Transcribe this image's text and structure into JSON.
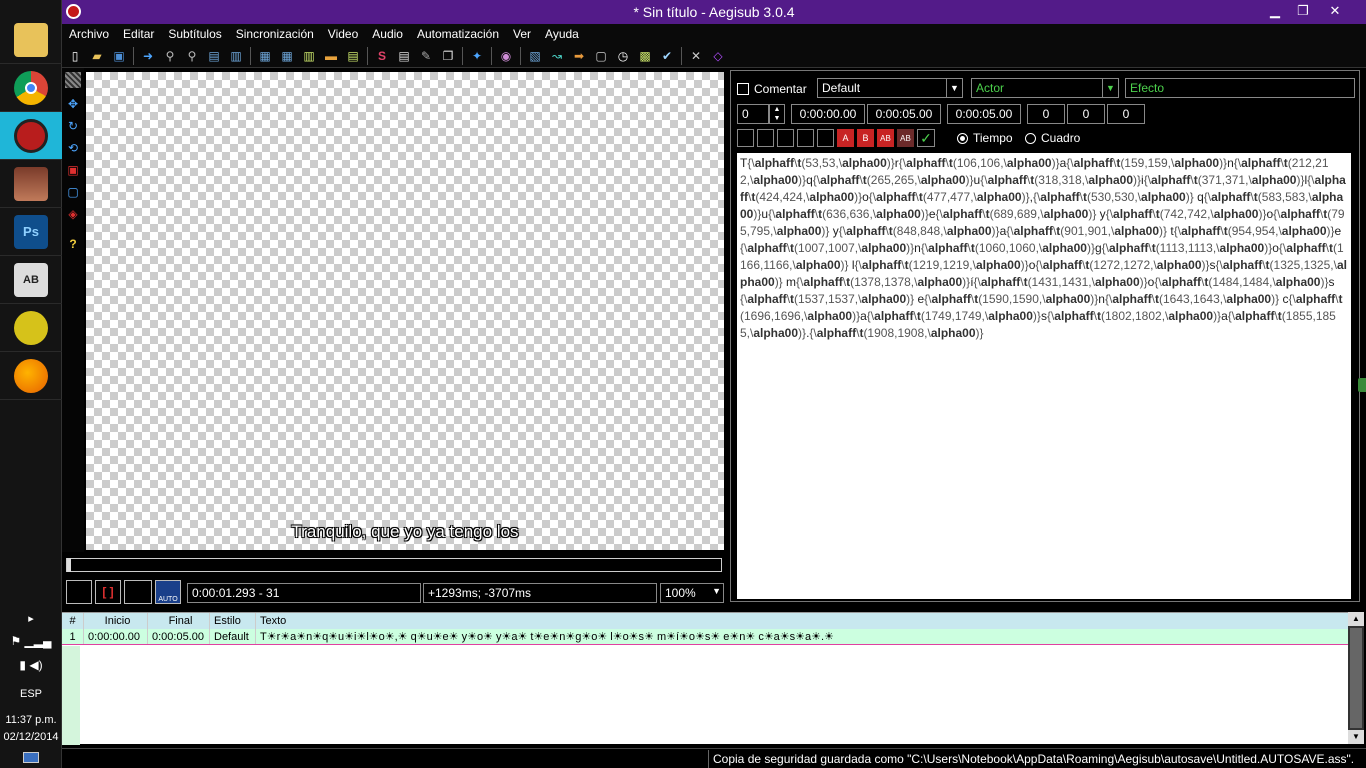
{
  "window": {
    "title": "* Sin título - Aegisub 3.0.4"
  },
  "menu": [
    "Archivo",
    "Editar",
    "Subtítulos",
    "Sincronización",
    "Video",
    "Audio",
    "Automatización",
    "Ver",
    "Ayuda"
  ],
  "taskbar": {
    "apps": [
      {
        "name": "file-explorer-icon",
        "label": ""
      },
      {
        "name": "chrome-icon",
        "label": ""
      },
      {
        "name": "aegisub-icon",
        "label": ""
      },
      {
        "name": "anime-avatar-icon",
        "label": ""
      },
      {
        "name": "photoshop-icon",
        "label": "Ps"
      },
      {
        "name": "translate-icon",
        "label": "AB"
      },
      {
        "name": "apex-icon",
        "label": ""
      },
      {
        "name": "firefox-icon",
        "label": ""
      }
    ],
    "language": "ESP",
    "time": "11:37 p.m.",
    "date": "02/12/2014"
  },
  "video": {
    "subtitle": "Tranquilo, que yo ya tengo los",
    "time_field": "0:00:01.293 - 31",
    "offset_field": "+1293ms; -3707ms",
    "zoom": "100%",
    "auto_label": "AUTO"
  },
  "edit": {
    "comment_label": "Comentar",
    "style": "Default",
    "actor_placeholder": "Actor",
    "effect_placeholder": "Efecto",
    "layer": "0",
    "start": "0:00:00.00",
    "end": "0:00:05.00",
    "duration": "0:00:05.00",
    "margin_l": "0",
    "margin_r": "0",
    "margin_v": "0",
    "time_radio": "Tiempo",
    "frame_radio": "Cuadro",
    "text": "T{\\alphaff\\t(53,53,\\alpha00)}r{\\alphaff\\t(106,106,\\alpha00)}a{\\alphaff\\t(159,159,\\alpha00)}n{\\alphaff\\t(212,212,\\alpha00)}q{\\alphaff\\t(265,265,\\alpha00)}u{\\alphaff\\t(318,318,\\alpha00)}i{\\alphaff\\t(371,371,\\alpha00)}l{\\alphaff\\t(424,424,\\alpha00)}o{\\alphaff\\t(477,477,\\alpha00)},{\\alphaff\\t(530,530,\\alpha00)} q{\\alphaff\\t(583,583,\\alpha00)}u{\\alphaff\\t(636,636,\\alpha00)}e{\\alphaff\\t(689,689,\\alpha00)} y{\\alphaff\\t(742,742,\\alpha00)}o{\\alphaff\\t(795,795,\\alpha00)} y{\\alphaff\\t(848,848,\\alpha00)}a{\\alphaff\\t(901,901,\\alpha00)} t{\\alphaff\\t(954,954,\\alpha00)}e{\\alphaff\\t(1007,1007,\\alpha00)}n{\\alphaff\\t(1060,1060,\\alpha00)}g{\\alphaff\\t(1113,1113,\\alpha00)}o{\\alphaff\\t(1166,1166,\\alpha00)} l{\\alphaff\\t(1219,1219,\\alpha00)}o{\\alphaff\\t(1272,1272,\\alpha00)}s{\\alphaff\\t(1325,1325,\\alpha00)} m{\\alphaff\\t(1378,1378,\\alpha00)}í{\\alphaff\\t(1431,1431,\\alpha00)}o{\\alphaff\\t(1484,1484,\\alpha00)}s{\\alphaff\\t(1537,1537,\\alpha00)} e{\\alphaff\\t(1590,1590,\\alpha00)}n{\\alphaff\\t(1643,1643,\\alpha00)} c{\\alphaff\\t(1696,1696,\\alpha00)}a{\\alphaff\\t(1749,1749,\\alpha00)}s{\\alphaff\\t(1802,1802,\\alpha00)}a{\\alphaff\\t(1855,1855,\\alpha00)}.{\\alphaff\\t(1908,1908,\\alpha00)}"
  },
  "grid": {
    "headers": [
      "#",
      "Inicio",
      "Final",
      "Estilo",
      "Texto"
    ],
    "rows": [
      {
        "num": "1",
        "start": "0:00:00.00",
        "end": "0:00:05.00",
        "style": "Default",
        "text": "T☀r☀a☀n☀q☀u☀i☀l☀o☀,☀ q☀u☀e☀ y☀o☀ y☀a☀ t☀e☀n☀g☀o☀ l☀o☀s☀ m☀í☀o☀s☀ e☀n☀ c☀a☀s☀a☀.☀"
      }
    ]
  },
  "status": {
    "message": "Copia de seguridad guardada como \"C:\\Users\\Notebook\\AppData\\Roaming\\Aegisub\\autosave\\Untitled.AUTOSAVE.ass\"."
  },
  "colors": {
    "titlebar": "#531b89",
    "accent": "#1fb6d8",
    "grid_row": "#ccffe0",
    "grid_header": "#c8e8ef",
    "green_text": "#4cd14c"
  }
}
